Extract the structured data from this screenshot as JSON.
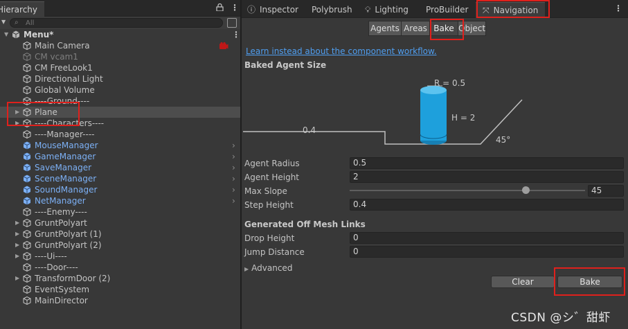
{
  "hierarchy": {
    "tab_title": "Hierarchy",
    "search_placeholder": "All",
    "items": [
      {
        "label": "Menu*",
        "style": "bold",
        "kind": "scene",
        "arrow": "expanded"
      },
      {
        "label": "Main Camera",
        "style": "normal",
        "kind": "object",
        "badge": "recording"
      },
      {
        "label": "CM vcam1",
        "style": "grey",
        "kind": "object"
      },
      {
        "label": "CM FreeLook1",
        "style": "normal",
        "kind": "object"
      },
      {
        "label": "Directional Light",
        "style": "normal",
        "kind": "object"
      },
      {
        "label": "Global Volume",
        "style": "normal",
        "kind": "object"
      },
      {
        "label": "----Ground----",
        "style": "normal",
        "kind": "object"
      },
      {
        "label": "Plane",
        "style": "normal",
        "kind": "object",
        "arrow": "collapsed",
        "selected": true
      },
      {
        "label": "----Characters----",
        "style": "normal",
        "kind": "object",
        "arrow": "collapsed"
      },
      {
        "label": "----Manager----",
        "style": "normal",
        "kind": "object"
      },
      {
        "label": "MouseManager",
        "style": "blue",
        "kind": "prefab",
        "chevron": true
      },
      {
        "label": "GameManager",
        "style": "blue",
        "kind": "prefab",
        "chevron": true
      },
      {
        "label": "SaveManager",
        "style": "blue",
        "kind": "prefab",
        "chevron": true
      },
      {
        "label": "SceneManager",
        "style": "blue",
        "kind": "prefab",
        "chevron": true
      },
      {
        "label": "SoundManager",
        "style": "blue",
        "kind": "prefab",
        "chevron": true
      },
      {
        "label": "NetManager",
        "style": "blue",
        "kind": "prefab",
        "chevron": true
      },
      {
        "label": "----Enemy----",
        "style": "normal",
        "kind": "object"
      },
      {
        "label": "GruntPolyart",
        "style": "normal",
        "kind": "object",
        "arrow": "collapsed"
      },
      {
        "label": "GruntPolyart (1)",
        "style": "normal",
        "kind": "object",
        "arrow": "collapsed"
      },
      {
        "label": "GruntPolyart (2)",
        "style": "normal",
        "kind": "object",
        "arrow": "collapsed"
      },
      {
        "label": "----Ui----",
        "style": "normal",
        "kind": "object",
        "arrow": "collapsed"
      },
      {
        "label": "----Door----",
        "style": "normal",
        "kind": "object"
      },
      {
        "label": "TransformDoor (2)",
        "style": "normal",
        "kind": "object",
        "arrow": "collapsed"
      },
      {
        "label": "EventSystem",
        "style": "normal",
        "kind": "object"
      },
      {
        "label": "MainDirector",
        "style": "normal",
        "kind": "object"
      }
    ]
  },
  "tabs": [
    {
      "label": "Inspector",
      "icon": "info-icon"
    },
    {
      "label": "Polybrush",
      "icon": ""
    },
    {
      "label": "Lighting",
      "icon": "bulb-icon"
    },
    {
      "label": "ProBuilder",
      "icon": ""
    },
    {
      "label": "Navigation",
      "icon": "navigation-icon",
      "active": true
    }
  ],
  "nav_sections": [
    "Agents",
    "Areas",
    "Bake",
    "Object"
  ],
  "active_section": "Bake",
  "learn_link": "Learn instead about the component workflow.",
  "baked_agent": {
    "title": "Baked Agent Size",
    "radius_label": "R = 0.5",
    "height_label": "H = 2",
    "step_label": "0.4",
    "slope_label": "45°"
  },
  "properties": {
    "agent_radius": {
      "label": "Agent Radius",
      "value": "0.5"
    },
    "agent_height": {
      "label": "Agent Height",
      "value": "2"
    },
    "max_slope": {
      "label": "Max Slope",
      "value": "45",
      "min": 0,
      "max": 60
    },
    "step_height": {
      "label": "Step Height",
      "value": "0.4"
    }
  },
  "offmesh": {
    "title": "Generated Off Mesh Links",
    "drop_height": {
      "label": "Drop Height",
      "value": "0"
    },
    "jump_distance": {
      "label": "Jump Distance",
      "value": "0"
    }
  },
  "advanced_label": "Advanced",
  "buttons": {
    "clear": "Clear",
    "bake": "Bake"
  },
  "watermark": "CSDN @シ゛甜虾",
  "colors": {
    "highlight": "#e0201c",
    "agent_cylinder": "#1ea0dc",
    "link": "#4f9ef0",
    "prefab_text": "#7cb0f5"
  }
}
